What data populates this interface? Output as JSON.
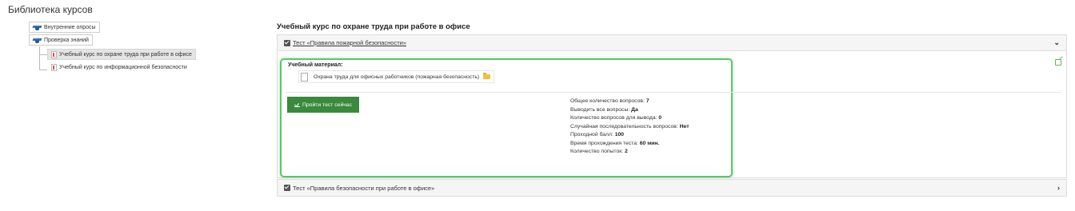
{
  "page": {
    "title": "Библиотека курсов"
  },
  "tree": {
    "items": [
      {
        "label": "Внутренние опросы",
        "icon": "graduation-cap-icon"
      },
      {
        "label": "Проверка знаний",
        "icon": "graduation-cap-icon"
      }
    ],
    "children": [
      {
        "label": "Учебный курс по охране труда при работе в офисе",
        "icon": "course-page-icon",
        "active": true
      },
      {
        "label": "Учебный курс по информационной безопасности",
        "icon": "course-page-icon",
        "active": false
      }
    ]
  },
  "course": {
    "title": "Учебный курс по охране труда при работе в офисе",
    "tests": [
      {
        "label": "Тест «Правила пожарной безопасности»",
        "expanded": true,
        "chevron": "⌄"
      },
      {
        "label": "Тест «Правила безопасности при работе в офисе»",
        "expanded": false,
        "chevron": "›"
      }
    ],
    "material": {
      "title": "Учебный материал:",
      "item": "Охрана труда для офисных работников (пожарная безопасность)"
    },
    "start_button": "Пройти тест сейчас",
    "stats": [
      {
        "label": "Общее количество вопросов:",
        "value": "7"
      },
      {
        "label": "Выводить все вопросы:",
        "value": "Да"
      },
      {
        "label": "Количество вопросов для вывода:",
        "value": "0"
      },
      {
        "label": "Случайная последовательность вопросов:",
        "value": "Нет"
      },
      {
        "label": "Проходной балл:",
        "value": "100"
      },
      {
        "label": "Время прохождения теста:",
        "value": "60 мин."
      },
      {
        "label": "Количество попыток:",
        "value": "2"
      }
    ]
  },
  "colors": {
    "accent_green": "#3a8a3d",
    "highlight_green": "#5cc66a",
    "folder": "#f0c040"
  }
}
